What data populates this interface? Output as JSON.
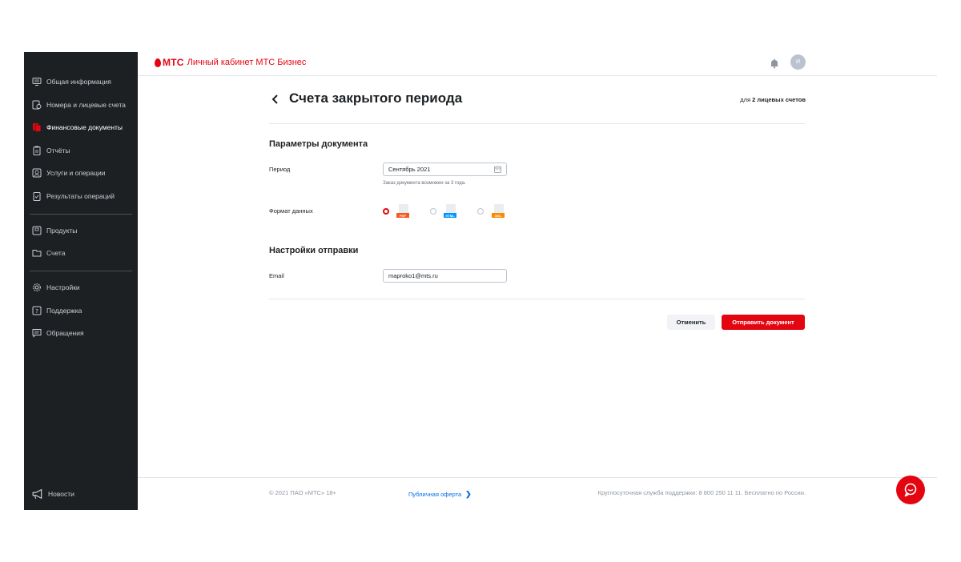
{
  "header": {
    "logo_brand": "МТС",
    "logo_subtitle": "Личный кабинет МТС Бизнес",
    "avatar_initial": "И"
  },
  "sidebar": {
    "items": [
      {
        "label": "Общая информация",
        "icon": "monitor-icon"
      },
      {
        "label": "Номера и лицевые счета",
        "icon": "phone-doc-icon"
      },
      {
        "label": "Финансовые документы",
        "icon": "finance-docs-icon",
        "active": true
      },
      {
        "label": "Отчёты",
        "icon": "report-icon"
      },
      {
        "label": "Услуги и операции",
        "icon": "services-icon"
      },
      {
        "label": "Результаты операций",
        "icon": "checklist-icon"
      },
      {
        "label": "Продукты",
        "icon": "products-icon"
      },
      {
        "label": "Счета",
        "icon": "folder-icon"
      },
      {
        "label": "Настройки",
        "icon": "gear-icon"
      },
      {
        "label": "Поддержка",
        "icon": "help-icon"
      },
      {
        "label": "Обращения",
        "icon": "chat-icon"
      }
    ],
    "news_label": "Новости"
  },
  "page": {
    "title": "Счета закрытого периода",
    "accounts_prefix": "для",
    "accounts_count": "2 лицевых счетов"
  },
  "doc_params": {
    "section_title": "Параметры документа",
    "period_label": "Период",
    "period_value": "Сентябрь 2021",
    "period_hint": "Заказ документа возможен за 3 года.",
    "format_label": "Формат данных",
    "formats": [
      {
        "name": "PDF",
        "color": "#f95721",
        "selected": true
      },
      {
        "name": "HTML",
        "color": "#0097fd",
        "selected": false
      },
      {
        "name": "XML",
        "color": "#fa8a00",
        "selected": false
      }
    ]
  },
  "send_settings": {
    "section_title": "Настройки отправки",
    "email_label": "Email",
    "email_value": "maproko1@mts.ru"
  },
  "actions": {
    "cancel_label": "Отменить",
    "send_label": "Отправить документ"
  },
  "footer": {
    "copyright": "© 2021 ПАО «МТС» 18+",
    "offer_label": "Публичная оферта",
    "support_text": "Круглосуточная служба поддержки: 8 800 250 11 11. Бесплатно по России."
  },
  "colors": {
    "accent": "#e30611",
    "sidebar_bg": "#1d2023",
    "link": "#0070e5"
  }
}
